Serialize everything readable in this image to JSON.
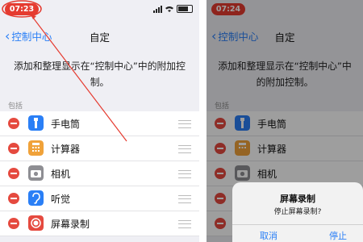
{
  "left": {
    "status": {
      "time": "07:23"
    },
    "nav": {
      "back_label": "控制中心",
      "title": "自定"
    },
    "description": "添加和整理显示在“控制中心”中的附加控制。",
    "section_header": "包括",
    "items": [
      {
        "label": "手电筒",
        "icon": "flashlight-icon"
      },
      {
        "label": "计算器",
        "icon": "calculator-icon"
      },
      {
        "label": "相机",
        "icon": "camera-icon"
      },
      {
        "label": "听觉",
        "icon": "ear-icon"
      },
      {
        "label": "屏幕录制",
        "icon": "screen-record-icon"
      }
    ]
  },
  "right": {
    "status": {
      "time": "07:24"
    },
    "nav": {
      "back_label": "控制中心",
      "title": "自定"
    },
    "description": "添加和整理显示在“控制中心”中的附加控制。",
    "section_header": "包括",
    "items": [
      {
        "label": "手电筒",
        "icon": "flashlight-icon"
      },
      {
        "label": "计算器",
        "icon": "calculator-icon"
      },
      {
        "label": "相机",
        "icon": "camera-icon"
      }
    ],
    "dialog": {
      "title": "屏幕录制",
      "message": "停止屏幕录制?",
      "cancel_label": "取消",
      "stop_label": "停止"
    }
  },
  "colors": {
    "accent": "#2a7ff6",
    "delete": "#e54a3f",
    "highlight": "#e53b30"
  }
}
